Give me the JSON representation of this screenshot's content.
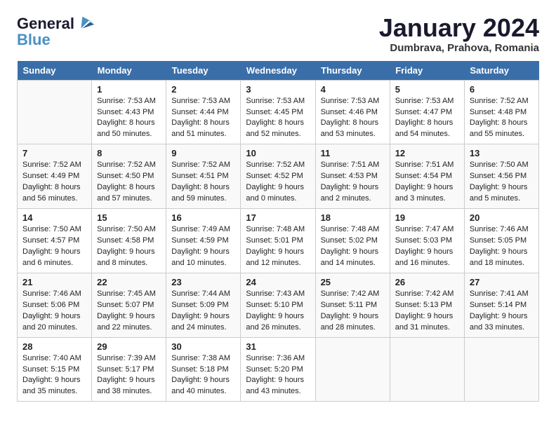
{
  "header": {
    "logo_line1": "General",
    "logo_line2": "Blue",
    "month_title": "January 2024",
    "location": "Dumbrava, Prahova, Romania"
  },
  "days_of_week": [
    "Sunday",
    "Monday",
    "Tuesday",
    "Wednesday",
    "Thursday",
    "Friday",
    "Saturday"
  ],
  "weeks": [
    [
      {
        "day": "",
        "info": ""
      },
      {
        "day": "1",
        "info": "Sunrise: 7:53 AM\nSunset: 4:43 PM\nDaylight: 8 hours\nand 50 minutes."
      },
      {
        "day": "2",
        "info": "Sunrise: 7:53 AM\nSunset: 4:44 PM\nDaylight: 8 hours\nand 51 minutes."
      },
      {
        "day": "3",
        "info": "Sunrise: 7:53 AM\nSunset: 4:45 PM\nDaylight: 8 hours\nand 52 minutes."
      },
      {
        "day": "4",
        "info": "Sunrise: 7:53 AM\nSunset: 4:46 PM\nDaylight: 8 hours\nand 53 minutes."
      },
      {
        "day": "5",
        "info": "Sunrise: 7:53 AM\nSunset: 4:47 PM\nDaylight: 8 hours\nand 54 minutes."
      },
      {
        "day": "6",
        "info": "Sunrise: 7:52 AM\nSunset: 4:48 PM\nDaylight: 8 hours\nand 55 minutes."
      }
    ],
    [
      {
        "day": "7",
        "info": "Sunrise: 7:52 AM\nSunset: 4:49 PM\nDaylight: 8 hours\nand 56 minutes."
      },
      {
        "day": "8",
        "info": "Sunrise: 7:52 AM\nSunset: 4:50 PM\nDaylight: 8 hours\nand 57 minutes."
      },
      {
        "day": "9",
        "info": "Sunrise: 7:52 AM\nSunset: 4:51 PM\nDaylight: 8 hours\nand 59 minutes."
      },
      {
        "day": "10",
        "info": "Sunrise: 7:52 AM\nSunset: 4:52 PM\nDaylight: 9 hours\nand 0 minutes."
      },
      {
        "day": "11",
        "info": "Sunrise: 7:51 AM\nSunset: 4:53 PM\nDaylight: 9 hours\nand 2 minutes."
      },
      {
        "day": "12",
        "info": "Sunrise: 7:51 AM\nSunset: 4:54 PM\nDaylight: 9 hours\nand 3 minutes."
      },
      {
        "day": "13",
        "info": "Sunrise: 7:50 AM\nSunset: 4:56 PM\nDaylight: 9 hours\nand 5 minutes."
      }
    ],
    [
      {
        "day": "14",
        "info": "Sunrise: 7:50 AM\nSunset: 4:57 PM\nDaylight: 9 hours\nand 6 minutes."
      },
      {
        "day": "15",
        "info": "Sunrise: 7:50 AM\nSunset: 4:58 PM\nDaylight: 9 hours\nand 8 minutes."
      },
      {
        "day": "16",
        "info": "Sunrise: 7:49 AM\nSunset: 4:59 PM\nDaylight: 9 hours\nand 10 minutes."
      },
      {
        "day": "17",
        "info": "Sunrise: 7:48 AM\nSunset: 5:01 PM\nDaylight: 9 hours\nand 12 minutes."
      },
      {
        "day": "18",
        "info": "Sunrise: 7:48 AM\nSunset: 5:02 PM\nDaylight: 9 hours\nand 14 minutes."
      },
      {
        "day": "19",
        "info": "Sunrise: 7:47 AM\nSunset: 5:03 PM\nDaylight: 9 hours\nand 16 minutes."
      },
      {
        "day": "20",
        "info": "Sunrise: 7:46 AM\nSunset: 5:05 PM\nDaylight: 9 hours\nand 18 minutes."
      }
    ],
    [
      {
        "day": "21",
        "info": "Sunrise: 7:46 AM\nSunset: 5:06 PM\nDaylight: 9 hours\nand 20 minutes."
      },
      {
        "day": "22",
        "info": "Sunrise: 7:45 AM\nSunset: 5:07 PM\nDaylight: 9 hours\nand 22 minutes."
      },
      {
        "day": "23",
        "info": "Sunrise: 7:44 AM\nSunset: 5:09 PM\nDaylight: 9 hours\nand 24 minutes."
      },
      {
        "day": "24",
        "info": "Sunrise: 7:43 AM\nSunset: 5:10 PM\nDaylight: 9 hours\nand 26 minutes."
      },
      {
        "day": "25",
        "info": "Sunrise: 7:42 AM\nSunset: 5:11 PM\nDaylight: 9 hours\nand 28 minutes."
      },
      {
        "day": "26",
        "info": "Sunrise: 7:42 AM\nSunset: 5:13 PM\nDaylight: 9 hours\nand 31 minutes."
      },
      {
        "day": "27",
        "info": "Sunrise: 7:41 AM\nSunset: 5:14 PM\nDaylight: 9 hours\nand 33 minutes."
      }
    ],
    [
      {
        "day": "28",
        "info": "Sunrise: 7:40 AM\nSunset: 5:15 PM\nDaylight: 9 hours\nand 35 minutes."
      },
      {
        "day": "29",
        "info": "Sunrise: 7:39 AM\nSunset: 5:17 PM\nDaylight: 9 hours\nand 38 minutes."
      },
      {
        "day": "30",
        "info": "Sunrise: 7:38 AM\nSunset: 5:18 PM\nDaylight: 9 hours\nand 40 minutes."
      },
      {
        "day": "31",
        "info": "Sunrise: 7:36 AM\nSunset: 5:20 PM\nDaylight: 9 hours\nand 43 minutes."
      },
      {
        "day": "",
        "info": ""
      },
      {
        "day": "",
        "info": ""
      },
      {
        "day": "",
        "info": ""
      }
    ]
  ]
}
